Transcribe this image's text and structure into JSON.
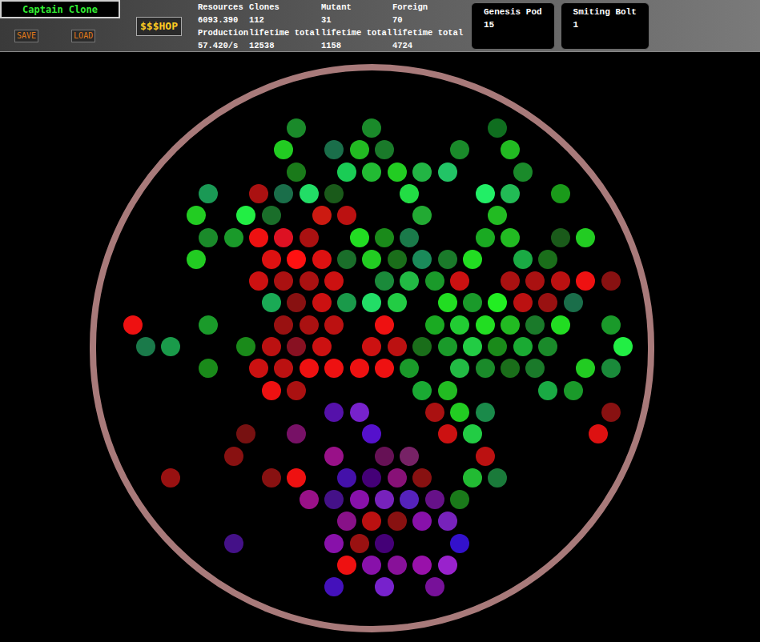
{
  "title": "Captain Clone",
  "buttons": [
    "SAVE",
    "LOAD"
  ],
  "shop": "$$$HOP",
  "stats": {
    "headers": [
      "Resources",
      "Clones",
      "Mutant",
      "Foreign"
    ],
    "values": [
      "6093.390",
      "112",
      "31",
      "70"
    ],
    "subheaders": [
      "Production",
      "lifetime total",
      "lifetime total",
      "lifetime total"
    ],
    "subvalues": [
      "57.420/s",
      "12538",
      "1158",
      "4724"
    ]
  },
  "powers": [
    {
      "name": "Genesis Pod",
      "count": "15"
    },
    {
      "name": "Smiting Bolt",
      "count": "1"
    }
  ],
  "board": {
    "rows": [
      [
        null,
        null,
        null,
        null,
        null,
        null,
        "#1a8a2a",
        null,
        null,
        "#1a8a2a",
        null,
        null,
        null,
        null,
        "#0f6e1f",
        null,
        null,
        null,
        null,
        null
      ],
      [
        null,
        null,
        null,
        null,
        null,
        null,
        "#22cc22",
        null,
        "#1a6e4a",
        "#22bb22",
        "#1a7a2a",
        null,
        null,
        "#1a8a2a",
        null,
        "#22bb22",
        null,
        null,
        null,
        null
      ],
      [
        null,
        null,
        null,
        null,
        null,
        null,
        "#1a7a1a",
        null,
        "#1acc55",
        "#22bb33",
        "#22cc22",
        "#22b544",
        "#22c466",
        null,
        null,
        "#1a8a2a",
        null,
        null,
        null,
        null
      ],
      [
        null,
        null,
        null,
        "#1a9955",
        null,
        "#aa1111",
        "#1a6e4a",
        "#22dd66",
        "#1a5a1a",
        null,
        null,
        "#22dd44",
        null,
        null,
        "#22ee66",
        "#22bb55",
        null,
        "#1a9a1a",
        null,
        null
      ],
      [
        null,
        null,
        "#22cc22",
        null,
        "#22ee44",
        "#1a6e2a",
        null,
        "#cc1a11",
        "#bb1111",
        null,
        null,
        "#22aa33",
        null,
        null,
        "#22bb22",
        null,
        null,
        null,
        null,
        null
      ],
      [
        null,
        null,
        null,
        "#1a8a2a",
        "#1a9a2a",
        "#ee1111",
        "#dd1122",
        "#aa1111",
        null,
        "#22dd22",
        "#1a8a1a",
        "#1a7a4a",
        null,
        null,
        "#1aaa22",
        "#22bb22",
        null,
        "#1a5a1a",
        "#22cc22",
        null
      ],
      [
        null,
        null,
        "#22cc22",
        null,
        null,
        "#dd1111",
        "#ff1111",
        "#dd1111",
        "#1a6e2a",
        "#22cc22",
        "#1a6e1a",
        "#1a8a5a",
        "#1a7a2a",
        "#22dd22",
        null,
        "#1aaa44",
        "#1a6e1a",
        null,
        null,
        null
      ],
      [
        null,
        null,
        null,
        null,
        null,
        "#cc1111",
        "#aa1111",
        "#aa1111",
        "#cc1111",
        null,
        "#1a8a3a",
        "#22bb44",
        "#1a9a2a",
        "#cc1111",
        null,
        "#aa1111",
        "#aa1111",
        "#bb1111",
        "#ee1111",
        "#881111"
      ],
      [
        null,
        null,
        null,
        null,
        null,
        "#1aaa55",
        "#881111",
        "#cc1111",
        "#1a9a4a",
        "#22dd66",
        "#22cc44",
        null,
        "#22dd22",
        "#1a9a2a",
        "#22ee22",
        "#bb1111",
        "#991111",
        "#1a6e4a",
        null,
        null
      ],
      [
        "#ee1111",
        null,
        null,
        "#1a9a2a",
        null,
        null,
        "#991111",
        "#aa1111",
        "#bb1111",
        null,
        "#ee1111",
        null,
        "#1aaa22",
        "#22cc33",
        "#22dd22",
        "#22bb22",
        "#1a7a2a",
        "#22dd22",
        null,
        "#1a9a2a"
      ],
      [
        "#1a7a4a",
        "#1a9a4a",
        null,
        null,
        "#1a8a1a",
        "#bb1111",
        "#881122",
        "#cc1111",
        null,
        "#cc1111",
        "#bb1111",
        "#1a6e1a",
        "#1a9a2a",
        "#22cc44",
        "#1a8a1a",
        "#1aaa33",
        "#1a8a2a",
        null,
        null,
        "#22ee44"
      ],
      [
        null,
        null,
        null,
        "#1a8a1a",
        null,
        "#cc1111",
        "#bb1111",
        "#ee1111",
        "#ee1111",
        "#ee1111",
        "#ee1111",
        "#1a9a2a",
        null,
        "#22bb44",
        "#1a8a2a",
        "#1a6e1a",
        "#1a7a2a",
        null,
        "#22cc22",
        "#1a8a3a"
      ],
      [
        null,
        null,
        null,
        null,
        null,
        "#ee1111",
        "#aa1111",
        null,
        null,
        null,
        null,
        "#1aaa33",
        "#22bb22",
        null,
        null,
        null,
        "#1aaa44",
        "#1a9a2a",
        null,
        null
      ],
      [
        null,
        null,
        null,
        null,
        null,
        null,
        null,
        null,
        "#5511aa",
        "#7722cc",
        null,
        null,
        "#aa1111",
        "#22cc22",
        "#1a8a4a",
        null,
        null,
        null,
        null,
        "#881111"
      ],
      [
        null,
        null,
        null,
        null,
        "#771111",
        null,
        "#771166",
        null,
        null,
        "#5511cc",
        null,
        null,
        "#cc1111",
        "#22cc44",
        null,
        null,
        null,
        null,
        "#dd1111",
        null
      ],
      [
        null,
        null,
        null,
        null,
        "#881111",
        null,
        null,
        null,
        "#991188",
        null,
        "#661155",
        "#772266",
        null,
        null,
        "#bb1111",
        null,
        null,
        null,
        null,
        null
      ],
      [
        null,
        "#991111",
        null,
        null,
        null,
        "#881111",
        "#ee1111",
        null,
        "#4411aa",
        "#440077",
        "#881177",
        "#881111",
        null,
        "#22bb33",
        "#1a7a3a",
        null,
        null,
        null,
        null,
        null
      ],
      [
        null,
        null,
        null,
        null,
        null,
        null,
        null,
        "#991188",
        "#441188",
        "#8811aa",
        "#7722bb",
        "#5522bb",
        "#661188",
        "#1a7a1a",
        null,
        null,
        null,
        null,
        null,
        null
      ],
      [
        null,
        null,
        null,
        null,
        null,
        null,
        null,
        null,
        "#881188",
        "#bb1111",
        "#881111",
        "#8811aa",
        "#7722bb",
        null,
        null,
        null,
        null,
        null,
        null,
        null
      ],
      [
        null,
        null,
        null,
        null,
        "#441188",
        null,
        null,
        null,
        "#8811aa",
        "#991111",
        "#440077",
        null,
        null,
        "#3311cc",
        null,
        null,
        null,
        null,
        null,
        null
      ],
      [
        null,
        null,
        null,
        null,
        null,
        null,
        null,
        null,
        "#ee1111",
        "#8811aa",
        "#881199",
        "#9911aa",
        "#9922cc",
        null,
        null,
        null,
        null,
        null,
        null,
        null
      ],
      [
        null,
        null,
        null,
        null,
        null,
        null,
        null,
        null,
        "#4411bb",
        null,
        "#7722cc",
        null,
        "#771199",
        null,
        null,
        null,
        null,
        null,
        null,
        null
      ]
    ]
  }
}
